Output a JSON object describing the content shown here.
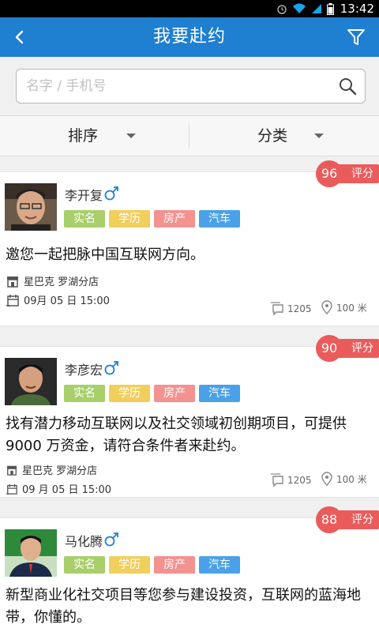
{
  "status_bar": {
    "time": "13:42"
  },
  "nav": {
    "title": "我要赴约"
  },
  "search": {
    "placeholder": "名字 / 手机号"
  },
  "sort_bar": {
    "sort_label": "排序",
    "category_label": "分类"
  },
  "score_label": "评分",
  "cards": [
    {
      "score": "96",
      "name": "李开复",
      "tags": [
        "实名",
        "学历",
        "房产",
        "汽车"
      ],
      "description": "邀您一起把脉中国互联网方向。",
      "location": "星巴克 罗湖分店",
      "datetime": "09月 05 日   15:00",
      "comments": "1205",
      "distance": "100 米"
    },
    {
      "score": "90",
      "name": "李彦宏",
      "tags": [
        "实名",
        "学历",
        "房产",
        "汽车"
      ],
      "description": "找有潜力移动互联网以及社交领域初创期项目，可提供9000 万资金，请符合条件者来赴约。",
      "location": "星巴克 罗湖分店",
      "datetime": "09 月 05 日   15:00",
      "comments": "1205",
      "distance": "100 米"
    },
    {
      "score": "88",
      "name": "马化腾",
      "tags": [
        "实名",
        "学历",
        "房产",
        "汽车"
      ],
      "description": "新型商业化社交项目等您参与建设投资，互联网的蓝海地带，你懂的。"
    }
  ],
  "colors": {
    "primary": "#1f7fd0",
    "score": "#ea5b5b",
    "tag_real": "#a8cf6a",
    "tag_edu": "#f1cf5d",
    "tag_house": "#f3928f",
    "tag_car": "#4aa1e8"
  }
}
